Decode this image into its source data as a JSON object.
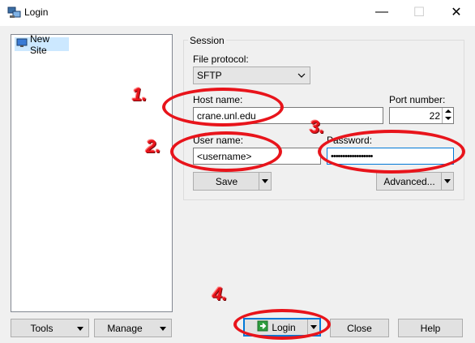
{
  "window": {
    "title": "Login",
    "minimize": "—",
    "maximize": "☐",
    "close": "✕"
  },
  "sites": {
    "items": [
      {
        "label": "New Site"
      }
    ]
  },
  "session": {
    "legend": "Session",
    "file_protocol": {
      "label": "File protocol:",
      "value": "SFTP"
    },
    "host_name": {
      "label": "Host name:",
      "value": "crane.unl.edu"
    },
    "port_number": {
      "label": "Port number:",
      "value": "22"
    },
    "user_name": {
      "label": "User name:",
      "value": "<username>"
    },
    "password": {
      "label": "Password:",
      "value": "••••••••••••••••••"
    },
    "save_label": "Save",
    "advanced_label": "Advanced..."
  },
  "footer": {
    "tools_label": "Tools",
    "manage_label": "Manage",
    "login_label": "Login",
    "close_label": "Close",
    "help_label": "Help"
  },
  "annotations": [
    {
      "number": "1."
    },
    {
      "number": "2."
    },
    {
      "number": "3."
    },
    {
      "number": "4."
    }
  ],
  "colors": {
    "annotation": "#e8141b",
    "selection": "#cce8ff",
    "focus_border": "#0078d7"
  }
}
